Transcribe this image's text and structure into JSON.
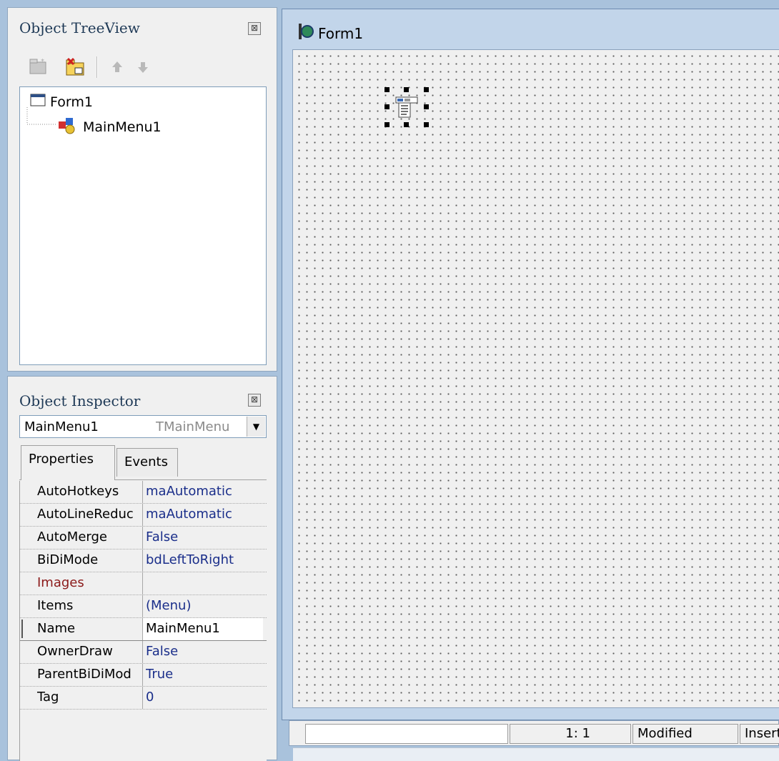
{
  "treeview": {
    "title": "Object TreeView",
    "nodes": [
      {
        "label": "Form1",
        "icon": "form-icon"
      },
      {
        "label": "MainMenu1",
        "icon": "mainmenu-icon"
      }
    ],
    "toolbar": [
      "new-item-icon",
      "delete-item-icon",
      "move-up-icon",
      "move-down-icon"
    ]
  },
  "inspector": {
    "title": "Object Inspector",
    "selected_object": "MainMenu1",
    "selected_type": "TMainMenu",
    "tabs": [
      "Properties",
      "Events"
    ],
    "active_tab": "Properties",
    "properties": [
      {
        "name": "AutoHotkeys",
        "value": "maAutomatic"
      },
      {
        "name": "AutoLineReduc",
        "value": "maAutomatic"
      },
      {
        "name": "AutoMerge",
        "value": "False"
      },
      {
        "name": "BiDiMode",
        "value": "bdLeftToRight"
      },
      {
        "name": "Images",
        "value": ""
      },
      {
        "name": "Items",
        "value": "(Menu)"
      },
      {
        "name": "Name",
        "value": "MainMenu1"
      },
      {
        "name": "OwnerDraw",
        "value": "False"
      },
      {
        "name": "ParentBiDiMod",
        "value": "True"
      },
      {
        "name": "Tag",
        "value": "0"
      }
    ]
  },
  "form": {
    "caption": "Form1"
  },
  "statusbar": {
    "position": "1:  1",
    "state": "Modified",
    "mode": "Insert"
  }
}
